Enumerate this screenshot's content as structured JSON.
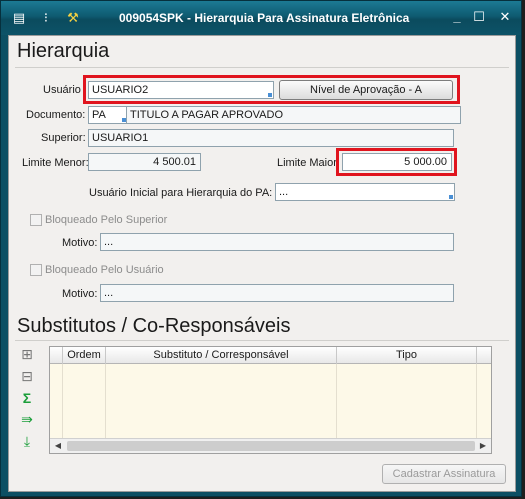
{
  "window": {
    "title": "009054SPK - Hierarquia Para Assinatura Eletrônica"
  },
  "section_hierarquia": {
    "heading": "Hierarquia",
    "usuario_label": "Usuário",
    "usuario_value": "USUARIO2",
    "nivel_button": "Nível de Aprovação - A",
    "documento_label": "Documento:",
    "documento_code": "PA",
    "documento_desc": "TITULO A PAGAR APROVADO",
    "superior_label": "Superior:",
    "superior_value": "USUARIO1",
    "limite_menor_label": "Limite Menor:",
    "limite_menor_value": "4 500.01",
    "limite_maior_label": "Limite Maior",
    "limite_maior_value": "5 000.00",
    "usuario_inicial_label": "Usuário Inicial para Hierarquia do PA:",
    "usuario_inicial_value": "...",
    "bloq_superior_label": "Bloqueado Pelo Superior",
    "motivo1_label": "Motivo:",
    "motivo1_value": "...",
    "bloq_usuario_label": "Bloqueado Pelo Usuário",
    "motivo2_label": "Motivo:",
    "motivo2_value": "..."
  },
  "section_substitutos": {
    "heading": "Substitutos / Co-Responsáveis",
    "columns": [
      "Ordem",
      "Substituto / Corresponsável",
      "Tipo"
    ]
  },
  "footer": {
    "cadastrar_button": "Cadastrar Assinatura"
  },
  "colors": {
    "titlebar": "#0e5a70",
    "highlight": "#e0141e",
    "grid_bg": "#fdf9e8"
  }
}
